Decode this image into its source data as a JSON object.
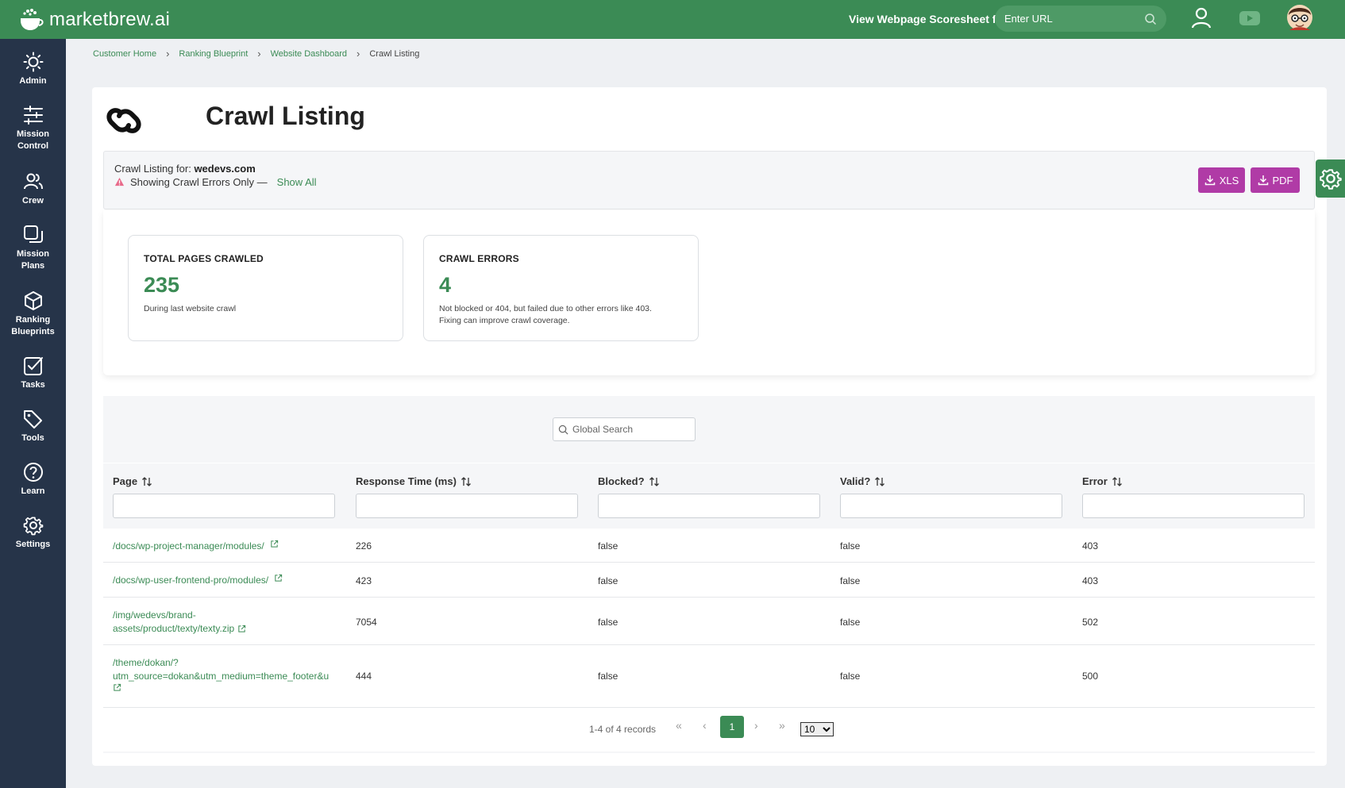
{
  "brand": {
    "name": "marketbrew.ai"
  },
  "topbar": {
    "scoresheet_label": "View Webpage Scoresheet for:",
    "url_placeholder": "Enter URL"
  },
  "sidebar": {
    "items": [
      {
        "label_1": "Admin",
        "label_2": ""
      },
      {
        "label_1": "Mission",
        "label_2": "Control"
      },
      {
        "label_1": "Crew",
        "label_2": ""
      },
      {
        "label_1": "Mission",
        "label_2": "Plans"
      },
      {
        "label_1": "Ranking",
        "label_2": "Blueprints"
      },
      {
        "label_1": "Tasks",
        "label_2": ""
      },
      {
        "label_1": "Tools",
        "label_2": ""
      },
      {
        "label_1": "Learn",
        "label_2": ""
      },
      {
        "label_1": "Settings",
        "label_2": ""
      }
    ]
  },
  "breadcrumb": {
    "items": [
      "Customer Home",
      "Ranking Blueprint",
      "Website Dashboard"
    ],
    "current": "Crawl Listing"
  },
  "page": {
    "title": "Crawl Listing"
  },
  "info": {
    "for_label": "Crawl Listing for:",
    "domain": "wedevs.com",
    "filter_text": "Showing Crawl Errors Only —",
    "show_all": "Show All",
    "xls_label": "XLS",
    "pdf_label": "PDF"
  },
  "stats": {
    "total": {
      "label": "TOTAL PAGES CRAWLED",
      "value": "235",
      "desc": "During last website crawl"
    },
    "errors": {
      "label": "CRAWL ERRORS",
      "value": "4",
      "desc_1": "Not blocked or 404, but failed due to other errors like 403.",
      "desc_2": "Fixing can improve crawl coverage."
    }
  },
  "table": {
    "search_placeholder": "Global Search",
    "columns": [
      "Page",
      "Response Time (ms)",
      "Blocked?",
      "Valid?",
      "Error"
    ],
    "rows": [
      {
        "page_1": "/docs/wp-project-manager/modules/",
        "page_2": "",
        "response": "226",
        "blocked": "false",
        "valid": "false",
        "error": "403"
      },
      {
        "page_1": "/docs/wp-user-frontend-pro/modules/",
        "page_2": "",
        "response": "423",
        "blocked": "false",
        "valid": "false",
        "error": "403"
      },
      {
        "page_1": "/img/wedevs/brand-",
        "page_2": "assets/product/texty/texty.zip",
        "response": "7054",
        "blocked": "false",
        "valid": "false",
        "error": "502"
      },
      {
        "page_1": "/theme/dokan/?",
        "page_2": "utm_source=dokan&utm_medium=theme_footer&u",
        "response": "444",
        "blocked": "false",
        "valid": "false",
        "error": "500"
      }
    ]
  },
  "pager": {
    "info": "1-4 of 4 records",
    "first": "«",
    "prev": "‹",
    "current": "1",
    "next": "›",
    "last": "»",
    "page_size": "10"
  },
  "colors": {
    "brand_green": "#3b8b55",
    "sidebar_navy": "#263449",
    "export_purple": "#b03ba6"
  }
}
